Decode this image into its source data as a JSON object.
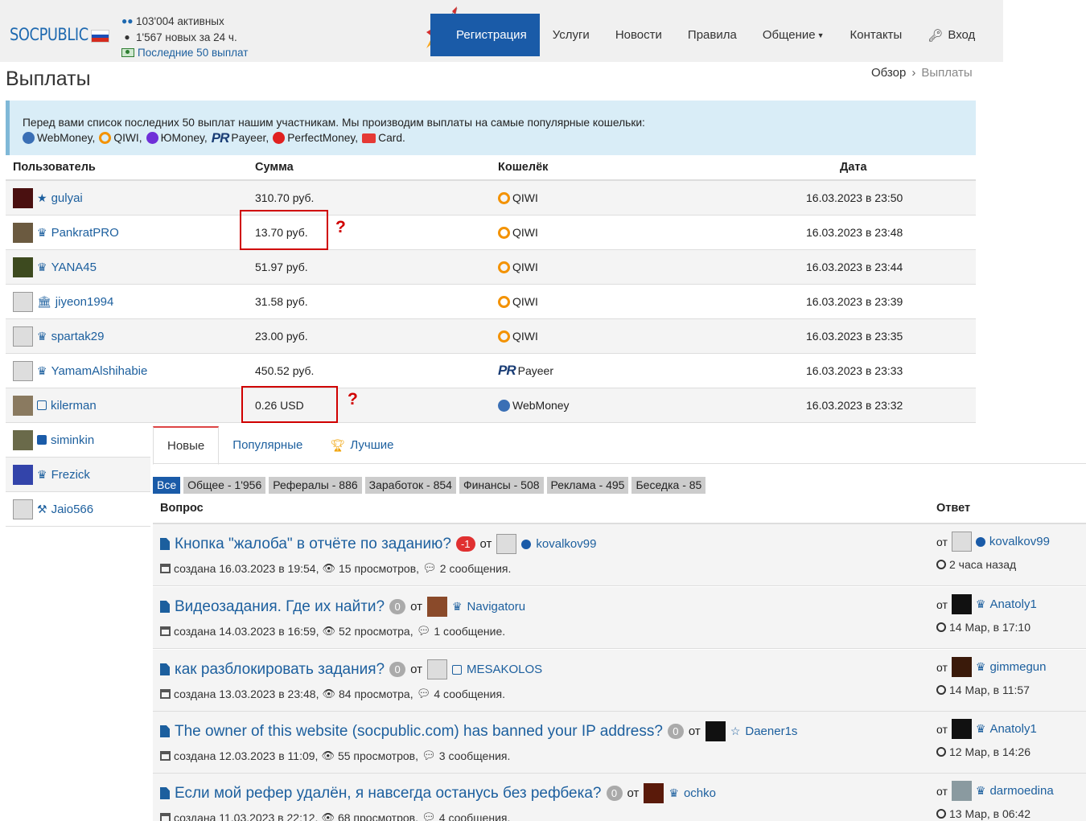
{
  "header": {
    "logo": "SOCPUBLIC",
    "stats": {
      "active": "103'004 активных",
      "new": "1'567 новых за 24 ч.",
      "last_payouts": "Последние 50 выплат"
    },
    "nav": [
      {
        "label": "Регистрация"
      },
      {
        "label": "Услуги"
      },
      {
        "label": "Новости"
      },
      {
        "label": "Правила"
      },
      {
        "label": "Общение"
      },
      {
        "label": "Контакты"
      },
      {
        "label": "Вход"
      }
    ]
  },
  "page": {
    "title": "Выплаты",
    "breadcrumb": {
      "root": "Обзор",
      "current": "Выплаты"
    }
  },
  "info": {
    "text": "Перед вами список последних 50 выплат нашим участникам. Мы производим выплаты на самые популярные кошельки:",
    "wallets": [
      "WebMoney,",
      "QIWI,",
      "ЮMoney,",
      "Payeer,",
      "PerfectMoney,",
      "Card."
    ]
  },
  "payouts": {
    "headers": {
      "user": "Пользователь",
      "sum": "Сумма",
      "wallet": "Кошелёк",
      "date": "Дата"
    },
    "rows": [
      {
        "user": "gulyai",
        "sum": "310.70 руб.",
        "wallet": "QIWI",
        "date": "16.03.2023 в 23:50"
      },
      {
        "user": "PankratPRO",
        "sum": "13.70 руб.",
        "wallet": "QIWI",
        "date": "16.03.2023 в 23:48"
      },
      {
        "user": "YANA45",
        "sum": "51.97 руб.",
        "wallet": "QIWI",
        "date": "16.03.2023 в 23:44"
      },
      {
        "user": "jiyeon1994",
        "sum": "31.58 руб.",
        "wallet": "QIWI",
        "date": "16.03.2023 в 23:39"
      },
      {
        "user": "spartak29",
        "sum": "23.00 руб.",
        "wallet": "QIWI",
        "date": "16.03.2023 в 23:35"
      },
      {
        "user": "YamamAlshihabie",
        "sum": "450.52 руб.",
        "wallet": "Payeer",
        "date": "16.03.2023 в 23:33"
      },
      {
        "user": "kilerman",
        "sum": "0.26 USD",
        "wallet": "WebMoney",
        "date": "16.03.2023 в 23:32"
      }
    ],
    "more_users": [
      "siminkin",
      "Frezick",
      "Jaio566"
    ],
    "annotation": "?"
  },
  "forum": {
    "tabs": [
      "Новые",
      "Популярные",
      "Лучшие"
    ],
    "categories": [
      "Все",
      "Общее - 1'956",
      "Рефералы - 886",
      "Заработок - 854",
      "Финансы - 508",
      "Реклама - 495",
      "Беседка - 85"
    ],
    "head": {
      "question": "Вопрос",
      "answer": "Ответ"
    },
    "ot": "от",
    "topics": [
      {
        "title": "Кнопка \"жалоба\" в отчёте по заданию?",
        "badge": "-1",
        "author": "kovalkov99",
        "created": "создана 16.03.2023 в 19:54,",
        "views": "15 просмотров,",
        "messages": "2 сообщения.",
        "ans_user": "kovalkov99",
        "ans_time": "2 часа назад"
      },
      {
        "title": "Видеозадания. Где их найти?",
        "badge": "0",
        "author": "Navigatoru",
        "created": "создана 14.03.2023 в 16:59,",
        "views": "52 просмотра,",
        "messages": "1 сообщение.",
        "ans_user": "Anatoly1",
        "ans_time": "14 Мар, в 17:10"
      },
      {
        "title": "как разблокировать задания?",
        "badge": "0",
        "author": "MESAKOLOS",
        "created": "создана 13.03.2023 в 23:48,",
        "views": "84 просмотра,",
        "messages": "4 сообщения.",
        "ans_user": "gimmegun",
        "ans_time": "14 Мар, в 11:57"
      },
      {
        "title": "The owner of this website (socpublic.com) has banned your IP address?",
        "badge": "0",
        "author": "Daener1s",
        "created": "создана 12.03.2023 в 11:09,",
        "views": "55 просмотров,",
        "messages": "3 сообщения.",
        "ans_user": "Anatoly1",
        "ans_time": "12 Мар, в 14:26"
      },
      {
        "title": "Если мой рефер удалён, я навсегда останусь без рефбека?",
        "badge": "0",
        "author": "ochko",
        "created": "создана 11.03.2023 в 22:12,",
        "views": "68 просмотров,",
        "messages": "4 сообщения.",
        "ans_user": "darmoedina",
        "ans_time": "13 Мар, в 06:42"
      }
    ]
  },
  "colors": {
    "brand": "#1a5ba8",
    "link": "#1c5f9e",
    "alert": "#d00000",
    "info_bg": "#d9edf7"
  }
}
